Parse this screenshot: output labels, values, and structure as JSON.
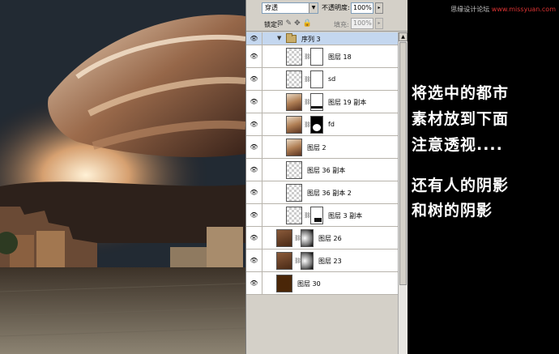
{
  "layers_panel": {
    "blend_mode": "穿透",
    "opacity_label": "不透明度:",
    "opacity_value": "100%",
    "lock_label": "锁定:",
    "lock_icons": "⊠✎✥🔒",
    "fill_label": "填充:",
    "fill_value": "100%",
    "group": {
      "name": "序列 3"
    },
    "layers": [
      {
        "name": "图层 18",
        "visible": true,
        "thumb": "checker",
        "mask": "white"
      },
      {
        "name": "sd",
        "visible": true,
        "thumb": "checker",
        "mask": "white"
      },
      {
        "name": "图层 19 副本",
        "visible": true,
        "thumb": "image",
        "mask": "white-foot"
      },
      {
        "name": "fd",
        "visible": true,
        "thumb": "image",
        "mask": "black-shape"
      },
      {
        "name": "图层 2",
        "visible": true,
        "thumb": "image",
        "mask": null
      },
      {
        "name": "图层 36 副本",
        "visible": true,
        "thumb": "checker",
        "mask": null
      },
      {
        "name": "图层 36 副本 2",
        "visible": true,
        "thumb": "checker",
        "mask": null
      },
      {
        "name": "图层 3 副本",
        "visible": true,
        "thumb": "checker",
        "mask": "white-foot2"
      },
      {
        "name": "图层 26",
        "visible": true,
        "thumb": "dark",
        "mask": "gradient"
      },
      {
        "name": "图层 23",
        "visible": true,
        "thumb": "dark",
        "mask": "gradient"
      },
      {
        "name": "图层 30",
        "visible": true,
        "thumb": "brown",
        "mask": null
      }
    ]
  },
  "watermark": {
    "site_name": "思缘设计论坛",
    "url": "www.missyuan.com"
  },
  "caption": {
    "lines": [
      "将选中的都市",
      "素材放到下面",
      "注意透视....",
      "还有人的阴影",
      "和树的阴影"
    ]
  },
  "icons": {
    "eye": "eye-icon",
    "folder": "folder-icon",
    "chain": "link-icon"
  }
}
